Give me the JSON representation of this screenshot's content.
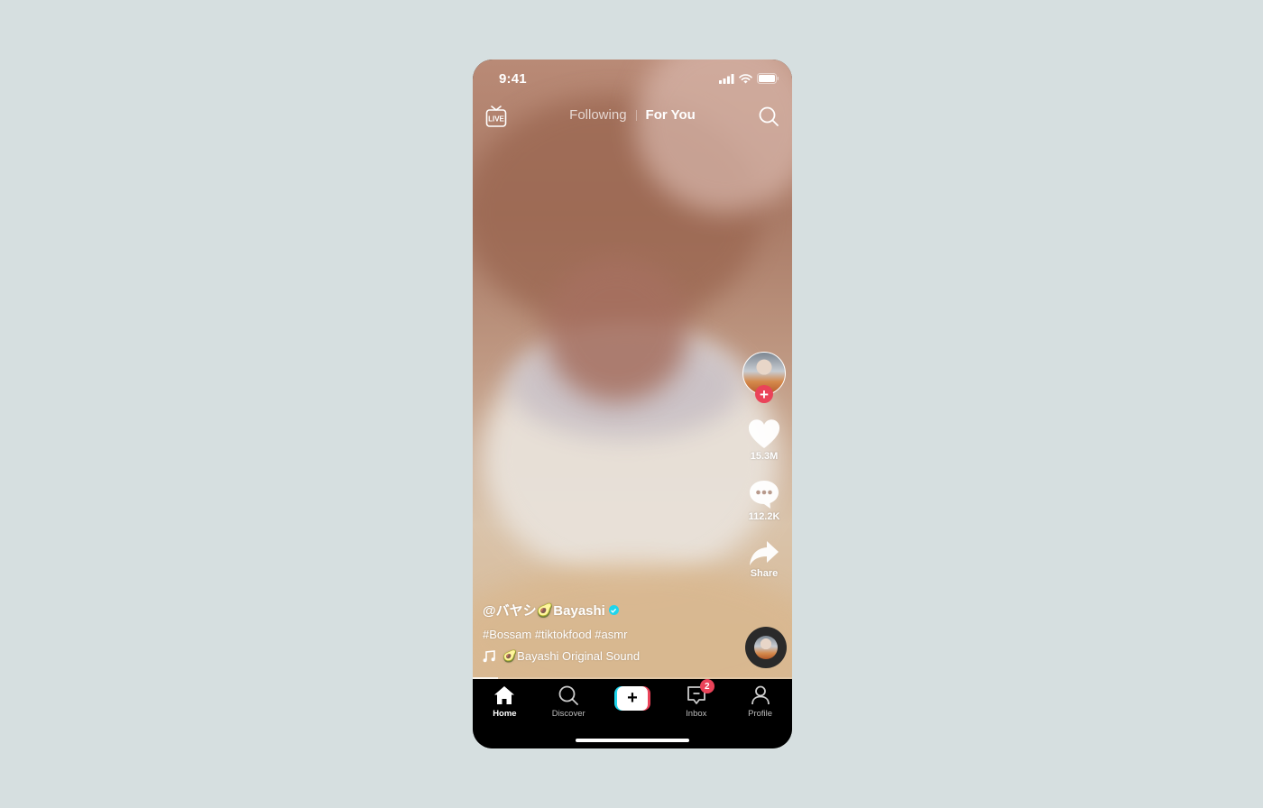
{
  "status_bar": {
    "time": "9:41"
  },
  "top_nav": {
    "live_label": "LIVE",
    "tabs": [
      {
        "label": "Following",
        "active": false
      },
      {
        "label": "For You",
        "active": true
      }
    ]
  },
  "side_actions": {
    "like_count": "15.3M",
    "comment_count": "112.2K",
    "share_label": "Share",
    "follow_symbol": "+"
  },
  "caption": {
    "username": "@バヤシ🥑Bayashi",
    "hashtags": "#Bossam #tiktokfood #asmr",
    "sound": "🥑Bayashi Original Sound"
  },
  "playback": {
    "progress": 0.08
  },
  "bottom_nav": {
    "items": [
      {
        "label": "Home",
        "icon": "home-icon",
        "active": true
      },
      {
        "label": "Discover",
        "icon": "search-icon",
        "active": false
      },
      {
        "label": "",
        "icon": "create-icon",
        "active": false
      },
      {
        "label": "Inbox",
        "icon": "inbox-icon",
        "active": false,
        "badge": "2"
      },
      {
        "label": "Profile",
        "icon": "profile-icon",
        "active": false
      }
    ],
    "create_symbol": "+"
  },
  "colors": {
    "accent_red": "#ea4359",
    "accent_cyan": "#20d5ec",
    "background": "#d6dfe0"
  }
}
